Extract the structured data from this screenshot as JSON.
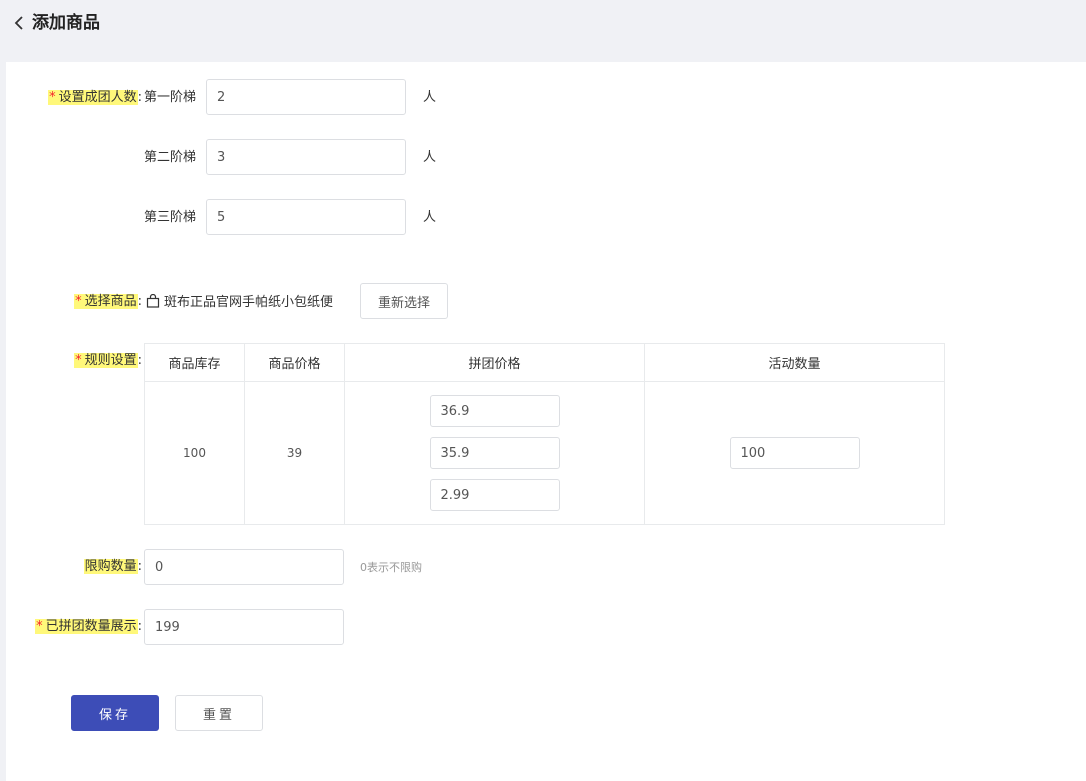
{
  "header": {
    "title": "添加商品"
  },
  "group_size": {
    "label": "设置成团人数",
    "tiers": [
      {
        "label": "第一阶梯",
        "value": "2",
        "unit": "人"
      },
      {
        "label": "第二阶梯",
        "value": "3",
        "unit": "人"
      },
      {
        "label": "第三阶梯",
        "value": "5",
        "unit": "人"
      }
    ]
  },
  "product": {
    "label": "选择商品",
    "name": "斑布正品官网手帕纸小包纸便",
    "reselect_label": "重新选择"
  },
  "rules": {
    "label": "规则设置",
    "columns": [
      "商品库存",
      "商品价格",
      "拼团价格",
      "活动数量"
    ],
    "stock": "100",
    "price": "39",
    "group_prices": [
      "36.9",
      "35.9",
      "2.99"
    ],
    "activity_qty": "100"
  },
  "purchase_limit": {
    "label": "限购数量",
    "value": "0",
    "hint": "0表示不限购"
  },
  "grouped_display": {
    "label": "已拼团数量展示",
    "value": "199"
  },
  "actions": {
    "save": "保存",
    "reset": "重置"
  },
  "colors": {
    "primary": "#3d4db7",
    "required": "#f5222d",
    "highlight": "#fff87a"
  }
}
